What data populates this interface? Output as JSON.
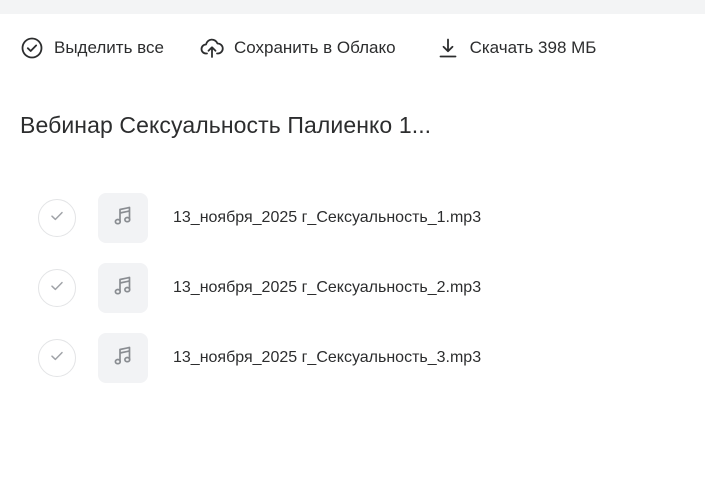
{
  "toolbar": {
    "select_all_label": "Выделить все",
    "save_cloud_label": "Сохранить в Облако",
    "download_label": "Скачать 398 МБ"
  },
  "folder": {
    "title": "Вебинар Сексуальность Палиенко 1..."
  },
  "files": [
    {
      "name": "13_ноября_2025 г_Сексуальность_1.mp3",
      "icon": "music-note-icon"
    },
    {
      "name": "13_ноября_2025 г_Сексуальность_2.mp3",
      "icon": "music-note-icon"
    },
    {
      "name": "13_ноября_2025 г_Сексуальность_3.mp3",
      "icon": "music-note-icon"
    }
  ],
  "colors": {
    "text": "#2c2d2e",
    "icon": "#2c2d2e",
    "muted_icon": "#a0a3a8",
    "thumb_bg": "#f2f3f5",
    "top_strip": "#f3f4f5"
  }
}
